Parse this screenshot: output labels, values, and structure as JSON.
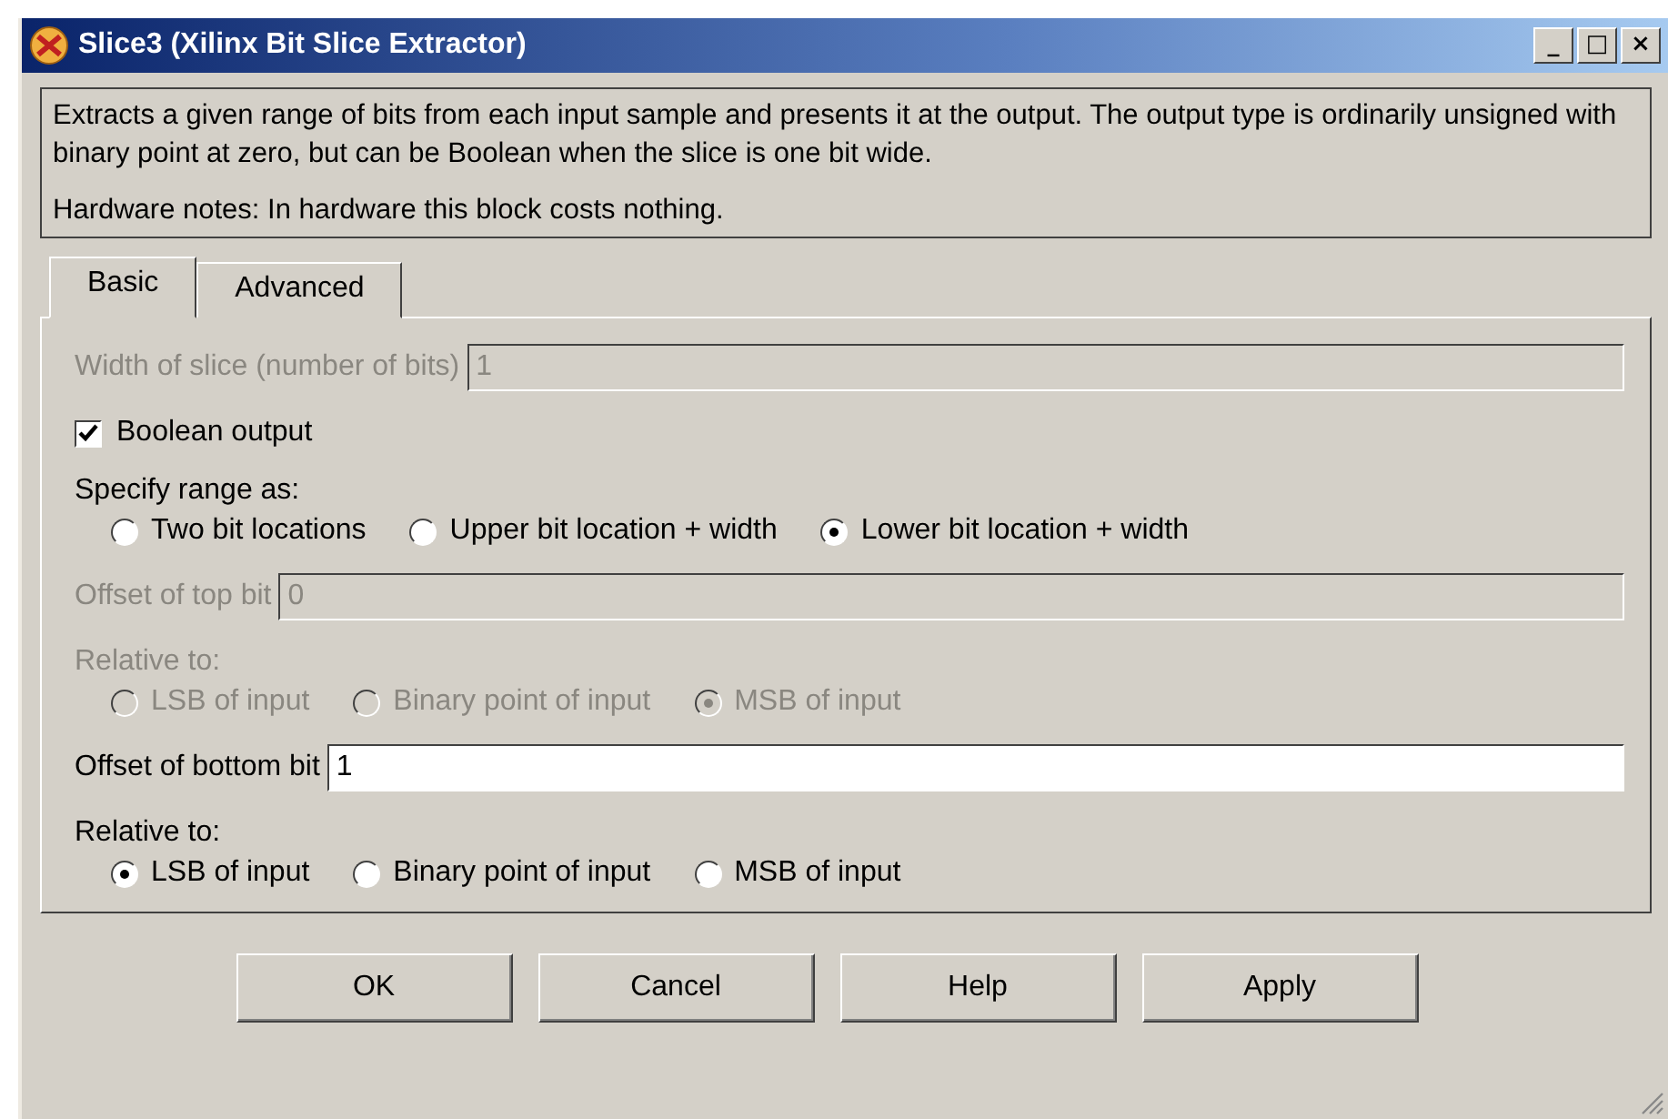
{
  "window": {
    "title": "Slice3 (Xilinx Bit Slice Extractor)",
    "controls": [
      "_",
      "□",
      "×"
    ]
  },
  "description": [
    "Extracts a given range of bits from each input sample and presents it at the output. The output type is ordinarily unsigned with binary point at zero, but can be Boolean when the slice is one bit wide.",
    "Hardware notes: In hardware this block costs nothing."
  ],
  "tabs": [
    {
      "label": "Basic",
      "selected": true
    },
    {
      "label": "Advanced",
      "selected": false
    }
  ],
  "items": [
    {
      "kind": "field",
      "label": "Width of slice (number of bits)",
      "value": "1",
      "disabled": true
    },
    {
      "kind": "checkbox",
      "label": "Boolean output",
      "checked": true,
      "disabled": false
    },
    {
      "kind": "radios",
      "label": "Specify range as:",
      "disabled": false,
      "options": [
        {
          "label": "Two bit locations",
          "selected": false
        },
        {
          "label": "Upper bit location + width",
          "selected": false
        },
        {
          "label": "Lower bit location + width",
          "selected": true
        }
      ]
    },
    {
      "kind": "field",
      "label": "Offset of top bit",
      "value": "0",
      "disabled": true
    },
    {
      "kind": "radios",
      "label": "Relative to:",
      "disabled": true,
      "options": [
        {
          "label": "LSB of input",
          "selected": false
        },
        {
          "label": "Binary point of input",
          "selected": false
        },
        {
          "label": "MSB of input",
          "selected": true
        }
      ]
    },
    {
      "kind": "field",
      "label": "Offset of bottom bit",
      "value": "1",
      "disabled": false
    },
    {
      "kind": "radios",
      "label": "Relative to:",
      "disabled": false,
      "options": [
        {
          "label": "LSB of input",
          "selected": true
        },
        {
          "label": "Binary point of input",
          "selected": false
        },
        {
          "label": "MSB of input",
          "selected": false
        }
      ]
    }
  ],
  "buttons": [
    "OK",
    "Cancel",
    "Help",
    "Apply"
  ]
}
